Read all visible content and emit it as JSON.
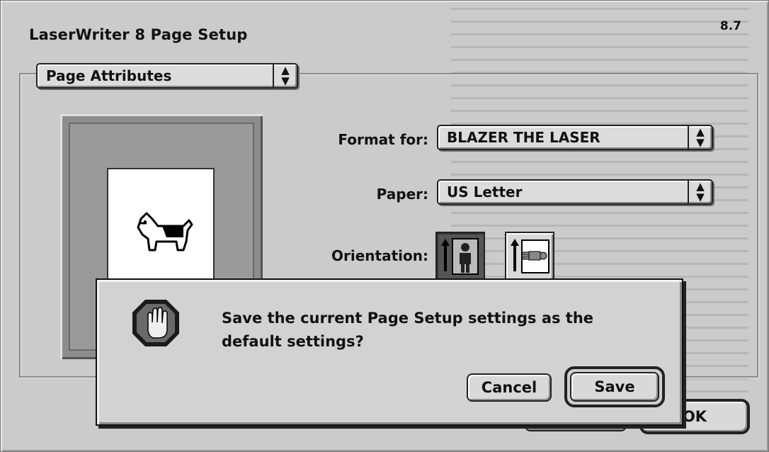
{
  "window": {
    "title": "LaserWriter 8 Page Setup",
    "version": "8.7"
  },
  "attributes_popup": {
    "selected": "Page Attributes"
  },
  "form": {
    "format_for_label": "Format for:",
    "format_for_value": "BLAZER THE LASER",
    "paper_label": "Paper:",
    "paper_value": "US Letter",
    "orientation_label": "Orientation:",
    "orientation_selected": "portrait"
  },
  "background_buttons": {
    "ok_label": "OK"
  },
  "alert": {
    "icon": "stop-icon",
    "message": "Save the current Page Setup settings as the default settings?",
    "cancel_label": "Cancel",
    "save_label": "Save"
  }
}
